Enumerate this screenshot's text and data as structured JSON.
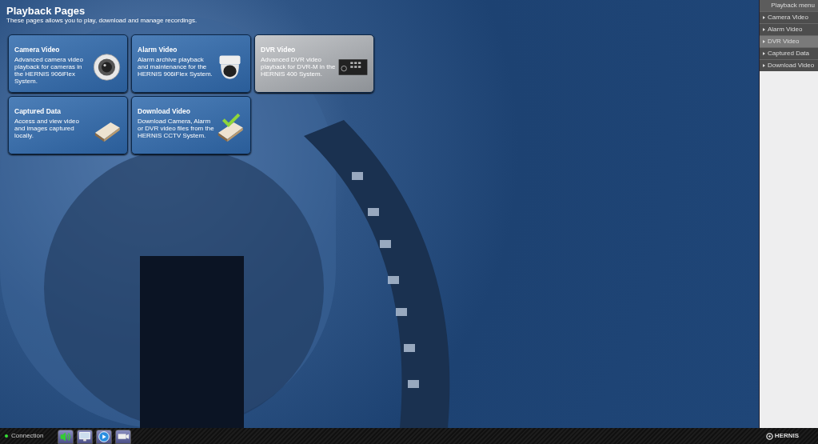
{
  "header": {
    "title": "Playback Pages",
    "subtitle": "These pages allows you to play, download and manage recordings."
  },
  "tiles": [
    {
      "title": "Camera Video",
      "description": "Advanced camera video playback for cameras in the HERNIS 906iFlex System.",
      "kind": "lens",
      "highlighted": false
    },
    {
      "title": "Alarm Video",
      "description": "Alarm archive playback and maintenance for the HERNIS 906iFlex System.",
      "kind": "dome",
      "highlighted": false
    },
    {
      "title": "DVR Video",
      "description": "Advanced DVR video playback for DVR-M in the HERNIS 400 System.",
      "kind": "dvr",
      "highlighted": true
    },
    {
      "title": "Captured Data",
      "description": "Access and view video and images captured locally.",
      "kind": "drive",
      "highlighted": false
    },
    {
      "title": "Download Video",
      "description": "Download Camera, Alarm or DVR video files from the HERNIS CCTV System.",
      "kind": "drive-check",
      "highlighted": false
    }
  ],
  "sidebar": {
    "title": "Playback menu",
    "items": [
      {
        "label": "Camera Video",
        "selected": false
      },
      {
        "label": "Alarm Video",
        "selected": false
      },
      {
        "label": "DVR Video",
        "selected": true
      },
      {
        "label": "Captured Data",
        "selected": false
      },
      {
        "label": "Download Video",
        "selected": false
      }
    ]
  },
  "status_bar": {
    "connection": {
      "label": "Connection",
      "connected": true
    },
    "tools": [
      {
        "kind": "sound"
      },
      {
        "kind": "monitor"
      },
      {
        "kind": "play"
      },
      {
        "kind": "camera"
      }
    ],
    "logo": "HERNIS"
  }
}
